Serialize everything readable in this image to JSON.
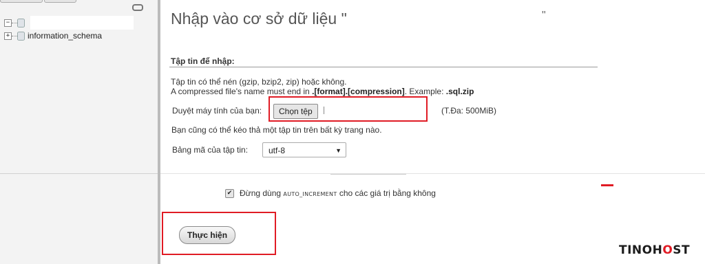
{
  "navigation": {
    "tree": [
      {
        "label": "",
        "toggle": "−"
      },
      {
        "label": "information_schema",
        "toggle": "+"
      }
    ]
  },
  "main": {
    "title": "Nhập vào cơ sở dữ liệu \"",
    "title_end": "\"",
    "file_section": {
      "heading": "Tập tin để nhập:",
      "compression_note": "Tập tin có thể nén (gzip, bzip2, zip) hoặc không.",
      "format_note_prefix": "A compressed file's name must end in ",
      "format_note_pattern": ".[format].[compression]",
      "format_note_mid": ". Example: ",
      "format_note_example": ".sql.zip",
      "browse_label": "Duyệt máy tính của bạn:",
      "choose_file_button": "Chọn tệp",
      "max_size": "(T.Đa: 500MiB)",
      "drag_note": "Bạn cũng có thể kéo thả một tập tin trên bất kỳ trang nào.",
      "charset_label": "Bảng mã của tập tin:",
      "charset_value": "utf-8"
    },
    "options": {
      "auto_increment_prefix": "Đừng dùng ",
      "auto_increment_code": "AUTO_INCREMENT",
      "auto_increment_suffix": " cho các giá trị bằng không",
      "auto_increment_checked": true
    },
    "go_button": "Thực hiện"
  },
  "brand": {
    "part1": "TINOH",
    "part2": "O",
    "part3": "ST",
    "accent": "#e01b24"
  },
  "colors": {
    "highlight": "#e01b24"
  }
}
